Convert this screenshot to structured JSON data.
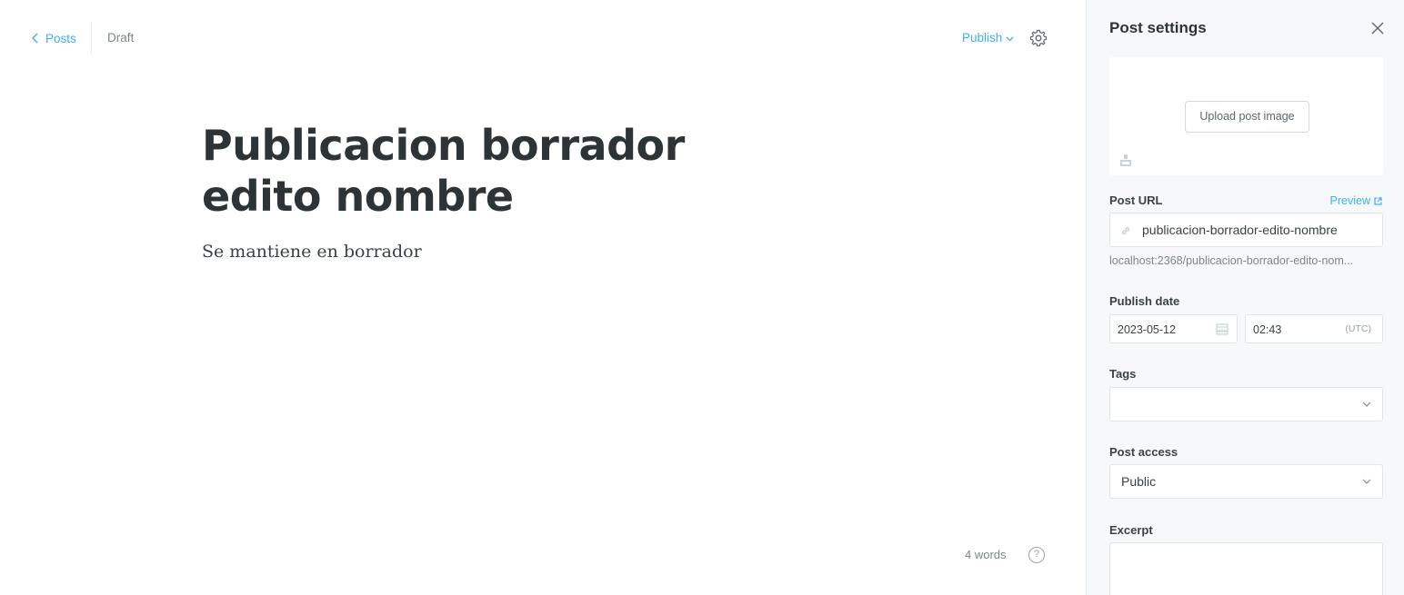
{
  "editor": {
    "back_label": "Posts",
    "status": "Draft",
    "publish_label": "Publish",
    "title": "Publicacion borrador edito nombre",
    "body": "Se mantiene en borrador",
    "word_count": "4 words",
    "help_label": "?"
  },
  "settings": {
    "title": "Post settings",
    "upload_label": "Upload post image",
    "post_url_label": "Post URL",
    "preview_label": "Preview",
    "slug": "publicacion-borrador-edito-nombre",
    "full_url": "localhost:2368/publicacion-borrador-edito-nom...",
    "publish_date_label": "Publish date",
    "date": "2023-05-12",
    "time": "02:43",
    "timezone": "(UTC)",
    "tags_label": "Tags",
    "access_label": "Post access",
    "access_value": "Public",
    "excerpt_label": "Excerpt"
  },
  "icons": {
    "back": "chevron-left-icon",
    "publish_dropdown": "chevron-down-icon",
    "settings": "gear-icon",
    "close": "close-icon",
    "image": "image-icon",
    "preview": "external-link-icon",
    "link": "link-icon",
    "calendar": "calendar-icon"
  },
  "colors": {
    "accent": "#3eb0ef",
    "text": "#2d3438",
    "muted": "#7d878a",
    "panel_bg": "#f6f8f9"
  }
}
